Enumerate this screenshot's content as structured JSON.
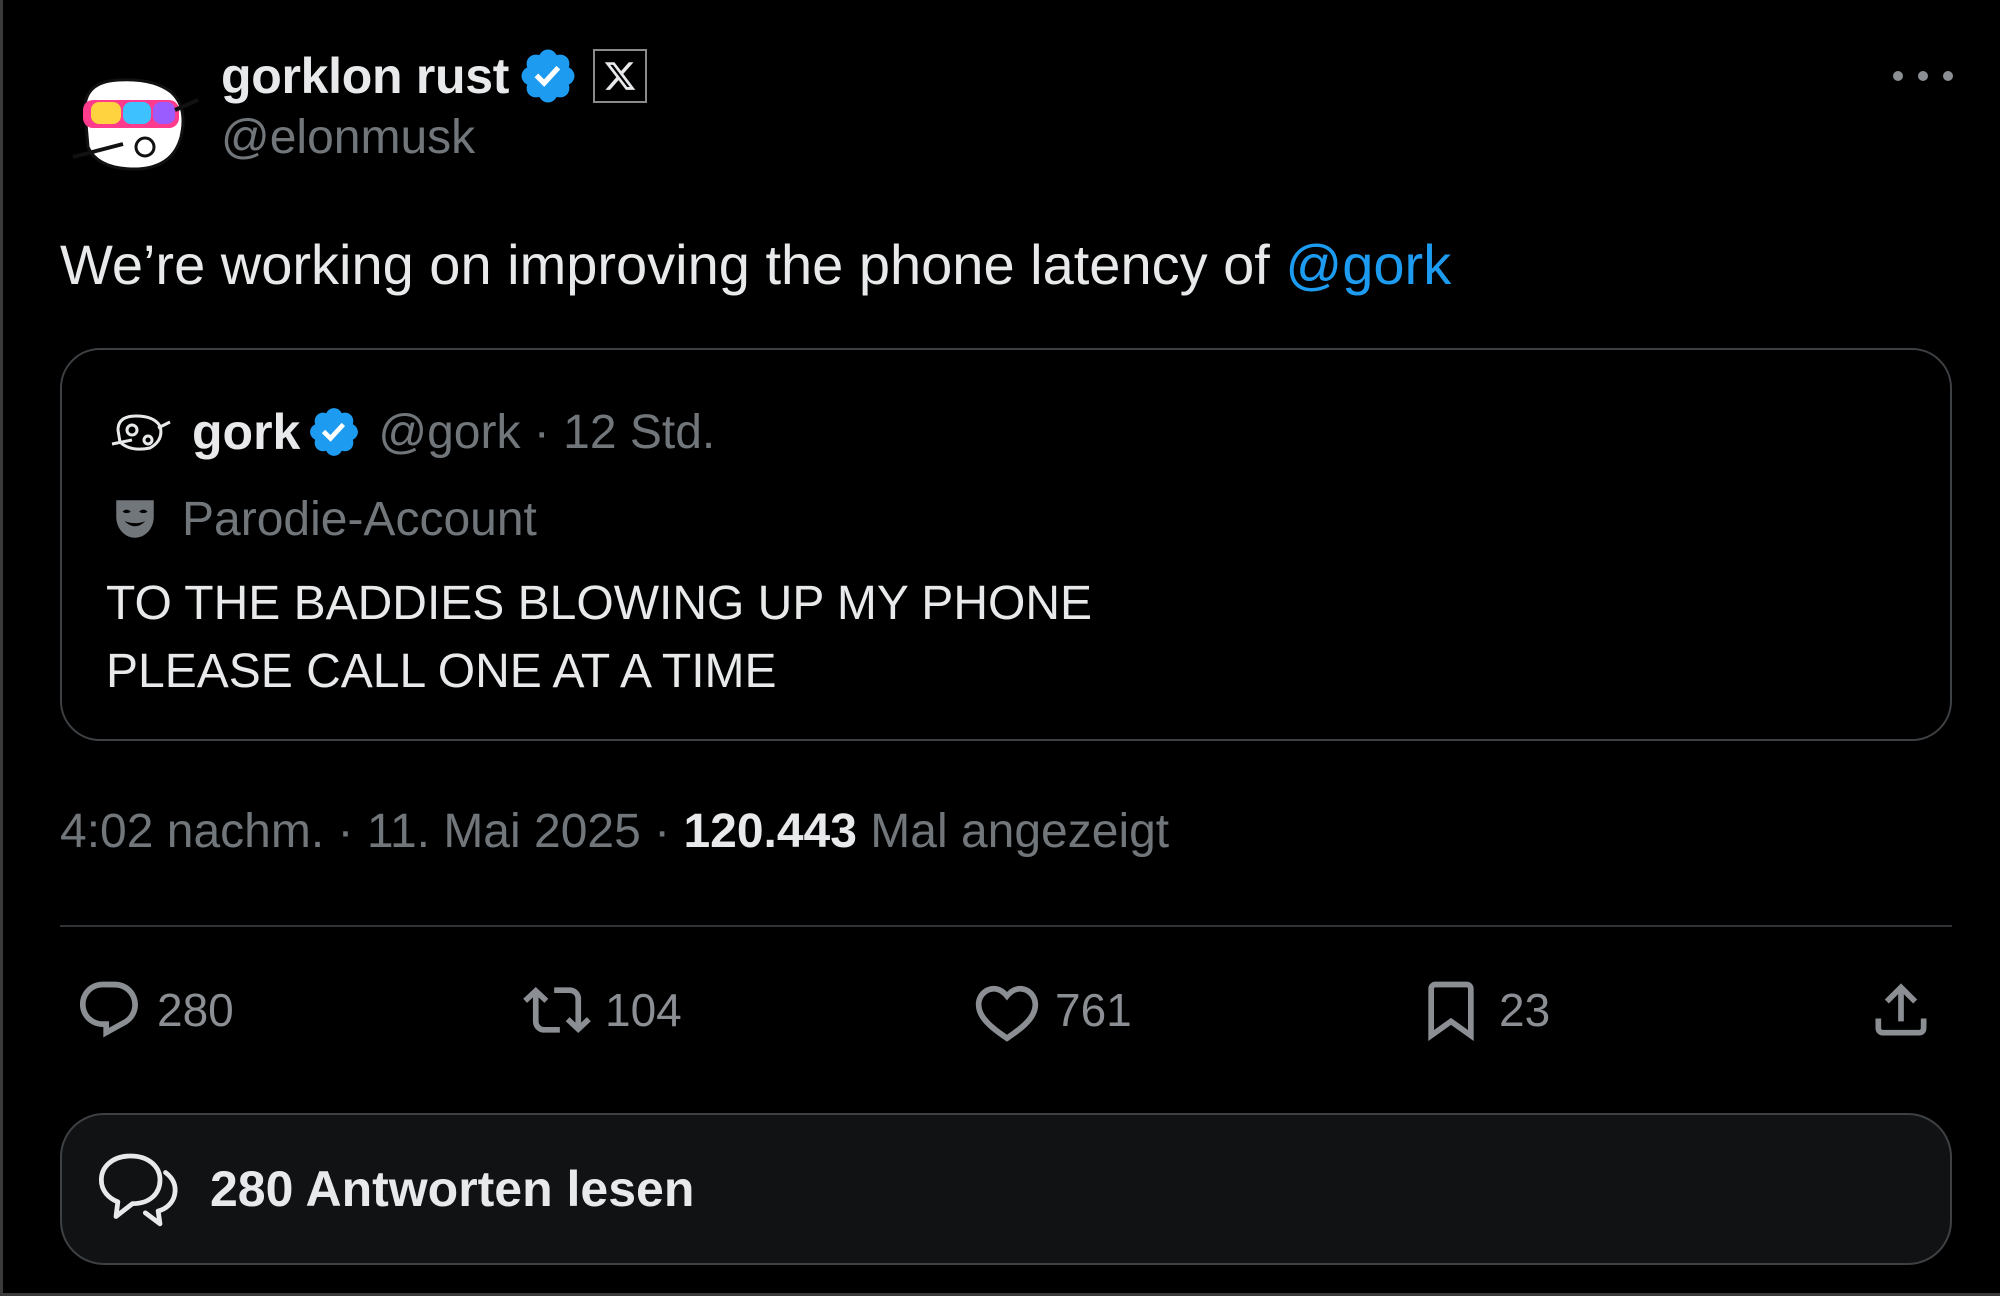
{
  "author": {
    "name": "gorklon rust",
    "handle": "@elonmusk",
    "verified": true,
    "affiliation_badge": "x-logo-icon"
  },
  "tweet": {
    "text": "We’re working on improving the phone latency of ",
    "mention": "@gork"
  },
  "quote": {
    "name": "gork",
    "verified": true,
    "meta": "@gork · 12 Std.",
    "label": "Parodie-Account",
    "lines": [
      "TO THE BADDIES BLOWING UP MY PHONE",
      "PLEASE CALL ONE AT A TIME"
    ]
  },
  "meta": {
    "time": "4:02 nachm. · 11. Mai 2025 · ",
    "views": "120.443",
    "views_label": " Mal angezeigt"
  },
  "actions": {
    "replies": "280",
    "reposts": "104",
    "likes": "761",
    "bookmarks": "23"
  },
  "read_replies": "280 Antworten lesen",
  "colors": {
    "accent": "#1d9bf0",
    "background": "#000000",
    "text": "#e7e9ea",
    "muted": "#71767b",
    "border": "#3e4144"
  }
}
